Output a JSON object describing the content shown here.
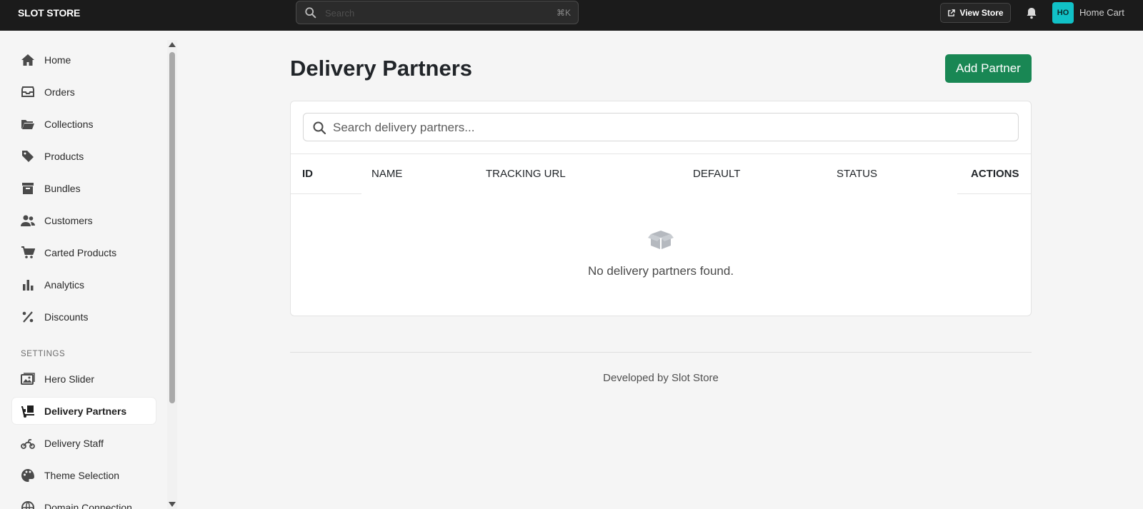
{
  "topbar": {
    "brand": "SLOT STORE",
    "search_placeholder": "Search",
    "search_shortcut": "⌘K",
    "view_store_label": "View Store",
    "avatar_initials": "HO",
    "store_name": "Home Cart"
  },
  "sidebar": {
    "items": [
      {
        "label": "Home",
        "icon": "home-icon"
      },
      {
        "label": "Orders",
        "icon": "inbox-icon"
      },
      {
        "label": "Collections",
        "icon": "folder-icon"
      },
      {
        "label": "Products",
        "icon": "tags-icon"
      },
      {
        "label": "Bundles",
        "icon": "archive-box-icon"
      },
      {
        "label": "Customers",
        "icon": "users-icon"
      },
      {
        "label": "Carted Products",
        "icon": "cart-icon"
      },
      {
        "label": "Analytics",
        "icon": "bar-chart-icon"
      },
      {
        "label": "Discounts",
        "icon": "percent-icon"
      }
    ],
    "settings_title": "SETTINGS",
    "settings_items": [
      {
        "label": "Hero Slider",
        "icon": "images-icon"
      },
      {
        "label": "Delivery Partners",
        "icon": "truck-loading-icon",
        "active": true
      },
      {
        "label": "Delivery Staff",
        "icon": "motorcycle-icon"
      },
      {
        "label": "Theme Selection",
        "icon": "palette-icon"
      },
      {
        "label": "Domain Connection",
        "icon": "globe-icon"
      }
    ]
  },
  "main": {
    "title": "Delivery Partners",
    "add_button": "Add Partner",
    "search_placeholder": "Search delivery partners...",
    "columns": [
      "ID",
      "NAME",
      "TRACKING URL",
      "DEFAULT",
      "STATUS",
      "ACTIONS"
    ],
    "empty_text": "No delivery partners found.",
    "footer": "Developed by Slot Store"
  },
  "colors": {
    "topbar_bg": "#1b1b1b",
    "primary_green": "#198754",
    "avatar_teal": "#11c1c7",
    "page_bg": "#f5f5f5"
  }
}
